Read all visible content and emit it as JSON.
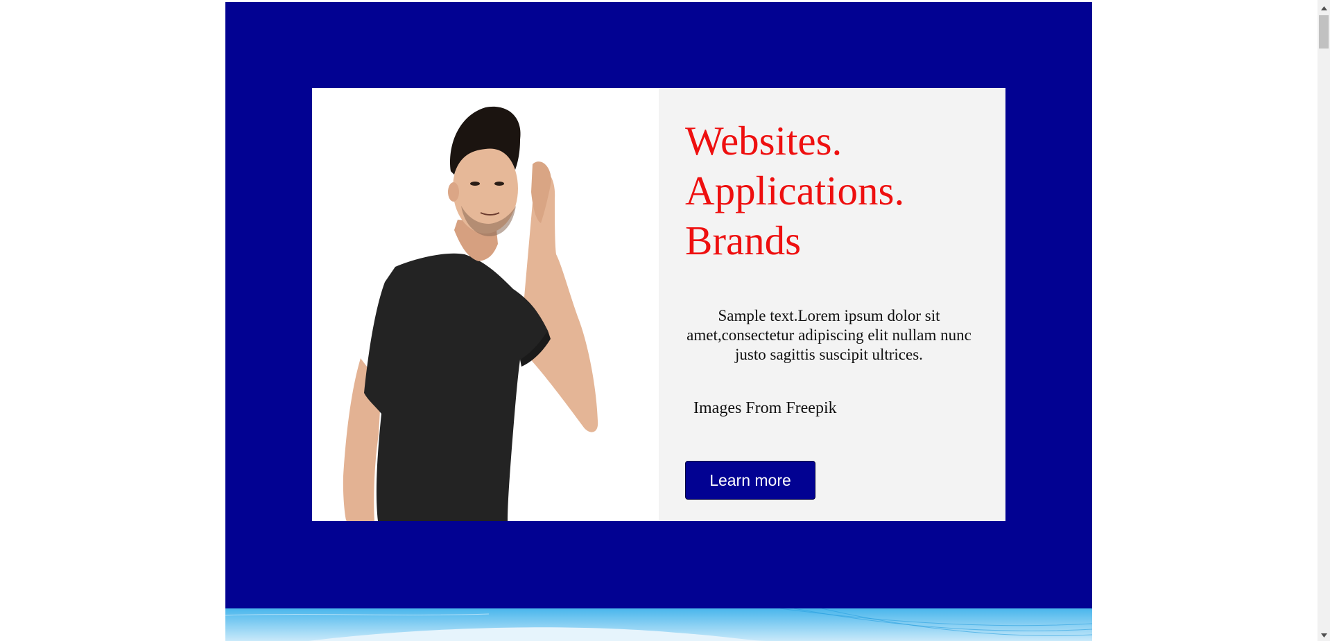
{
  "hero": {
    "headline": [
      "Websites.",
      "Applications.",
      "Brands"
    ],
    "body": "Sample text.Lorem ipsum dolor sit amet,consectetur adipiscing elit nullam nunc justo sagittis suscipit ultrices.",
    "credit": "Images From Freepik",
    "button_label": "Learn more",
    "image_icon": "man-listening-photo"
  },
  "colors": {
    "section_background": "#020292",
    "headline": "#ee0f0f",
    "panel_background": "#f3f3f3",
    "button_background": "#020292",
    "button_text": "#ffffff"
  },
  "scrollbar": {
    "up_icon": "chevron-up-icon",
    "down_icon": "chevron-down-icon"
  }
}
